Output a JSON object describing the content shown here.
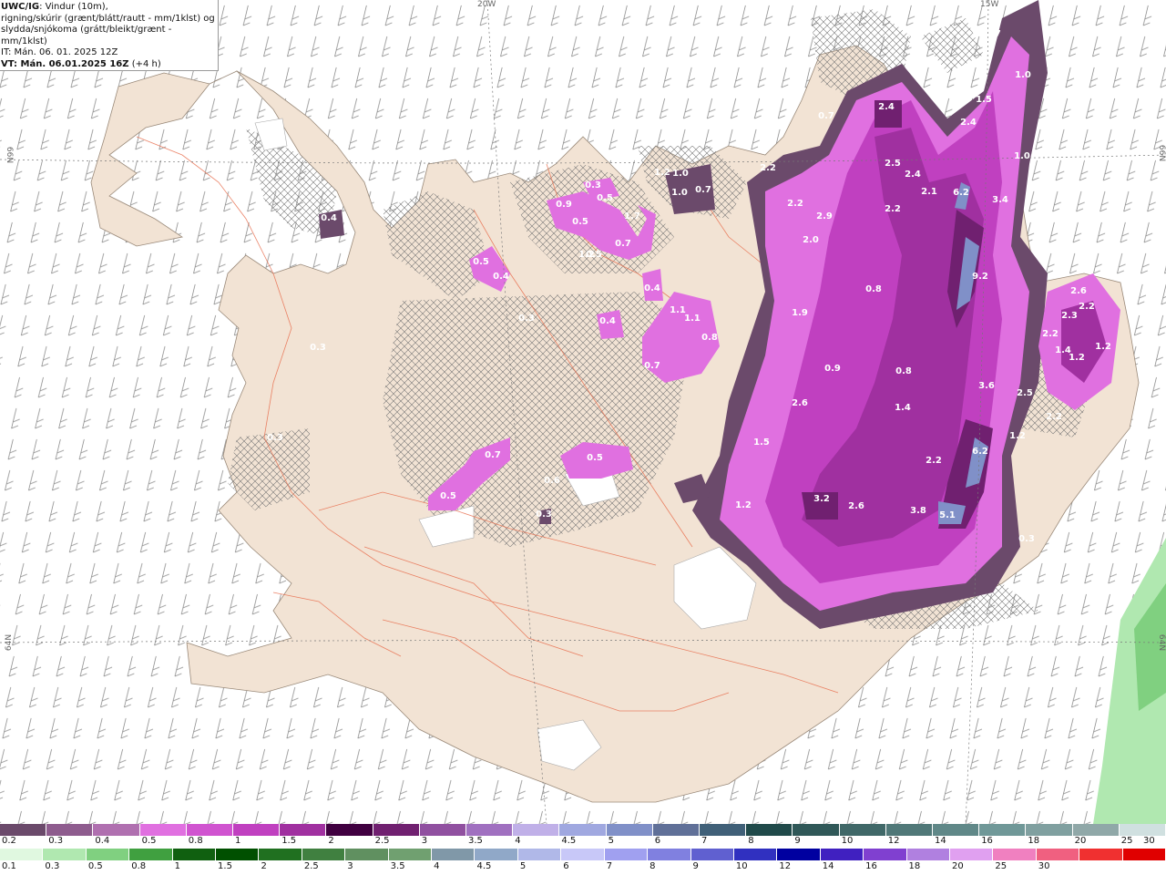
{
  "title": {
    "model": "UWC/IG",
    "line1": ": Vindur (10m),",
    "line2": "rigning/skúrir (grænt/blátt/rautt - mm/1klst) og",
    "line3": "slydda/snjókoma (grátt/bleikt/grænt - mm/1klst)",
    "issue": "IT: Mán. 06. 01. 2025 12Z",
    "valid_bold": "VT: Mán. 06.01.2025 16Z",
    "valid_offset": " (+4 h)"
  },
  "graticule": {
    "lon_20w": "20W",
    "lon_15w": "15W",
    "lat_66n_left": "66N",
    "lat_66n_right": "66N",
    "lat_64n_left": "64N",
    "lat_64n_right": "64N"
  },
  "precip_labels": [
    "0.7",
    "1.0",
    "1.5",
    "2.4",
    "2.4",
    "0.7",
    "2.5",
    "2.4",
    "2.2",
    "2.1",
    "6.2",
    "3.4",
    "1.0",
    "2.2",
    "2.9",
    "2.2",
    "2.0",
    "9.2",
    "0.8",
    "1.9",
    "2.6",
    "2.2",
    "2.3",
    "2.2",
    "1.4",
    "1.2",
    "1.2",
    "0.9",
    "0.8",
    "1.4",
    "3.6",
    "2.5",
    "2.6",
    "6.2",
    "1.5",
    "2.2",
    "1.2",
    "2.2",
    "1.2",
    "3.2",
    "2.6",
    "3.8",
    "5.1",
    "0.3",
    "1.2",
    "1.0",
    "0.7",
    "1.0",
    "0.3",
    "0.5",
    "0.9",
    "0.5",
    "0.7",
    "1.7",
    "0.5",
    "0.4",
    "0.4",
    "0.3",
    "0.5",
    "1.1",
    "1.1",
    "0.8",
    "0.7",
    "0.4",
    "0.4",
    "0.3",
    "0.7",
    "0.5",
    "0.6",
    "0.3",
    "1.2",
    "0.3",
    "0.5"
  ],
  "snow_scale": {
    "colors": [
      "#6b4a6b",
      "#8e5c8e",
      "#b070b0",
      "#e070e0",
      "#d054d0",
      "#c040c0",
      "#a030a0",
      "#400040",
      "#702070",
      "#9050a0",
      "#a070c0",
      "#c0b0e8",
      "#a0a8e0",
      "#8090c8",
      "#607098",
      "#406078",
      "#204a4a",
      "#305858",
      "#406868",
      "#507878",
      "#608888",
      "#709898",
      "#80a0a0",
      "#90a8a8",
      "#d0e0e0"
    ],
    "ticks": [
      "0.2",
      "0.3",
      "0.4",
      "0.5",
      "0.8",
      "1",
      "1.5",
      "2",
      "2.5",
      "3",
      "3.5",
      "4",
      "4.5",
      "5",
      "6",
      "7",
      "8",
      "9",
      "10",
      "12",
      "14",
      "16",
      "18",
      "20",
      "25",
      "30"
    ]
  },
  "rain_scale": {
    "colors": [
      "#e0f8e0",
      "#b0e8b0",
      "#80d080",
      "#40a040",
      "#106010",
      "#005000",
      "#207020",
      "#408040",
      "#609060",
      "#70a070",
      "#8098a8",
      "#90a8c8",
      "#b0b8e8",
      "#c8c8f8",
      "#a0a0f0",
      "#8080e0",
      "#6060d0",
      "#3030c0",
      "#0000a0",
      "#4020c0",
      "#8040d0",
      "#b080e0",
      "#e0a0f0",
      "#f080c0",
      "#f06080",
      "#f03030",
      "#e00000"
    ],
    "ticks": [
      "0.1",
      "0.3",
      "0.5",
      "0.8",
      "1",
      "1.5",
      "2",
      "2.5",
      "3",
      "3.5",
      "4",
      "4.5",
      "5",
      "6",
      "7",
      "8",
      "9",
      "10",
      "12",
      "14",
      "16",
      "18",
      "20",
      "25",
      "30"
    ]
  }
}
